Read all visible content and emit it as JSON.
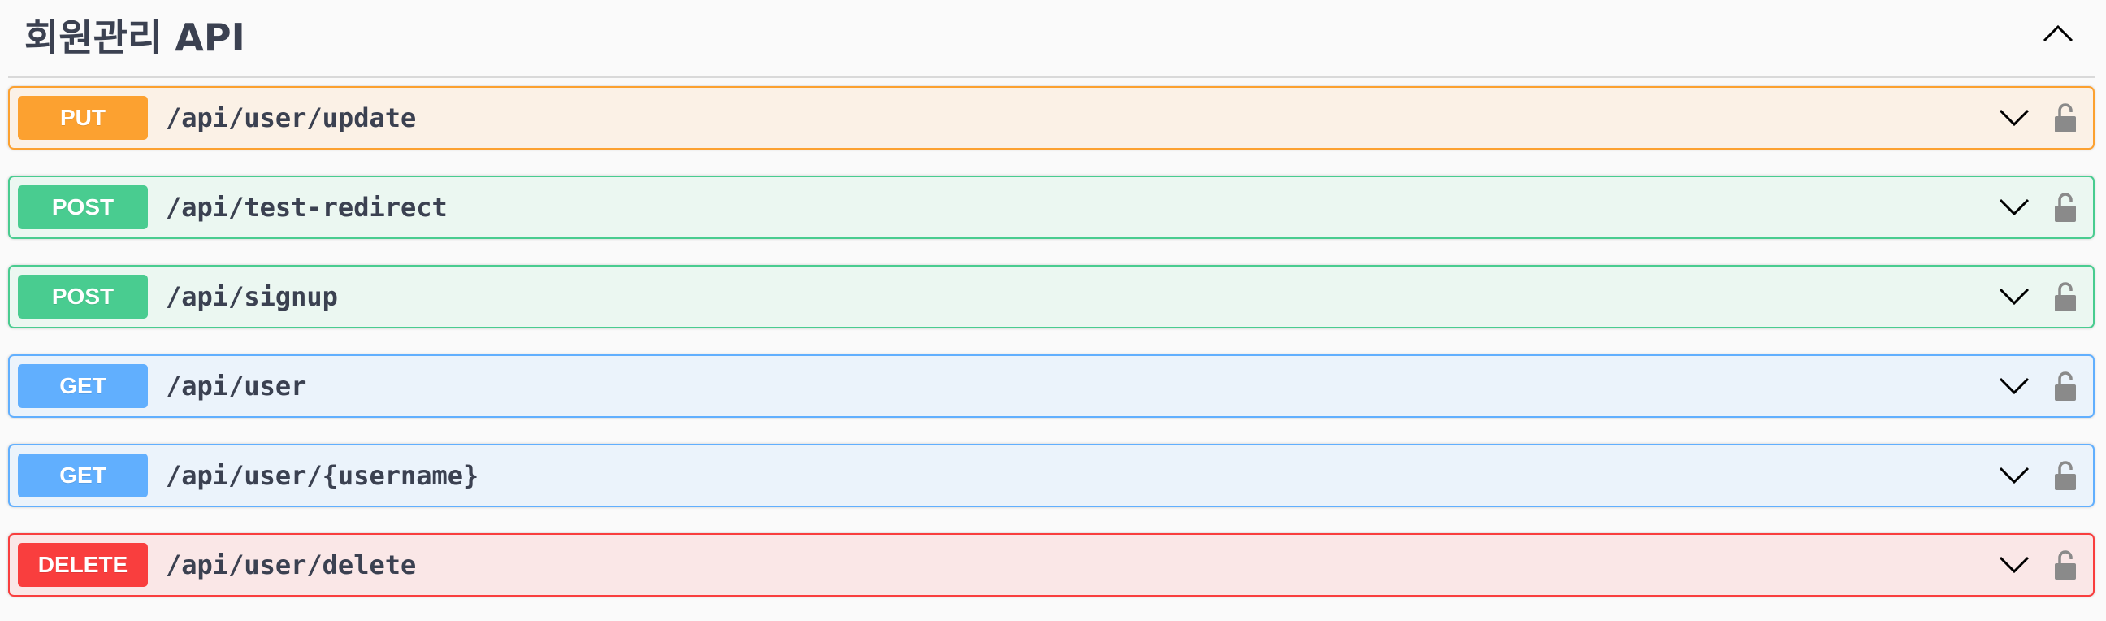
{
  "tag": {
    "title": "회원관리 API",
    "collapse_icon": "chevron-up-icon"
  },
  "operations": [
    {
      "method": "PUT",
      "path": "/api/user/update",
      "color": "#fca130",
      "locked": false
    },
    {
      "method": "POST",
      "path": "/api/test-redirect",
      "color": "#49cc90",
      "locked": false
    },
    {
      "method": "POST",
      "path": "/api/signup",
      "color": "#49cc90",
      "locked": false
    },
    {
      "method": "GET",
      "path": "/api/user",
      "color": "#61affe",
      "locked": false
    },
    {
      "method": "GET",
      "path": "/api/user/{username}",
      "color": "#61affe",
      "locked": false
    },
    {
      "method": "DELETE",
      "path": "/api/user/delete",
      "color": "#f93e3e",
      "locked": false
    }
  ],
  "icons": {
    "expand": "chevron-down-icon",
    "auth": "unlock-icon"
  }
}
